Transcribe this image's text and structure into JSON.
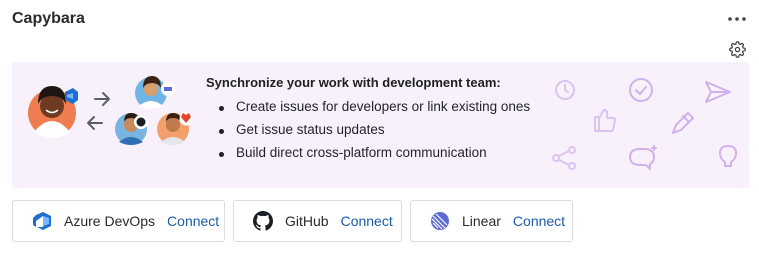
{
  "widget": {
    "title": "Capybara",
    "more_icon": "more-horizontal-icon",
    "settings_icon": "gear-icon"
  },
  "banner": {
    "heading": "Synchronize your work with development team:",
    "bullets": [
      "Create issues for developers or link existing ones",
      "Get issue status updates",
      "Build direct cross-platform communication"
    ],
    "illustration_icons": [
      "avatar",
      "arrow-right-icon",
      "arrow-left-icon",
      "avatar",
      "avatar",
      "avatar"
    ],
    "decor_icons": [
      "clock-icon",
      "check-circle-icon",
      "send-icon",
      "thumbs-up-icon",
      "pencil-icon",
      "share-icon",
      "chat-bubble-icon",
      "lightbulb-icon"
    ],
    "background": "#f8f1fc",
    "decor_color": "#dcc3ef"
  },
  "integrations": [
    {
      "name": "Azure DevOps",
      "action": "Connect",
      "icon": "azure-devops-logo-icon"
    },
    {
      "name": "GitHub",
      "action": "Connect",
      "icon": "github-logo-icon"
    },
    {
      "name": "Linear",
      "action": "Connect",
      "icon": "linear-logo-icon"
    }
  ],
  "colors": {
    "link": "#1a5aa8",
    "azure": "#1f6fd2",
    "github": "#1b1f24",
    "linear": "#5e6ad2"
  }
}
